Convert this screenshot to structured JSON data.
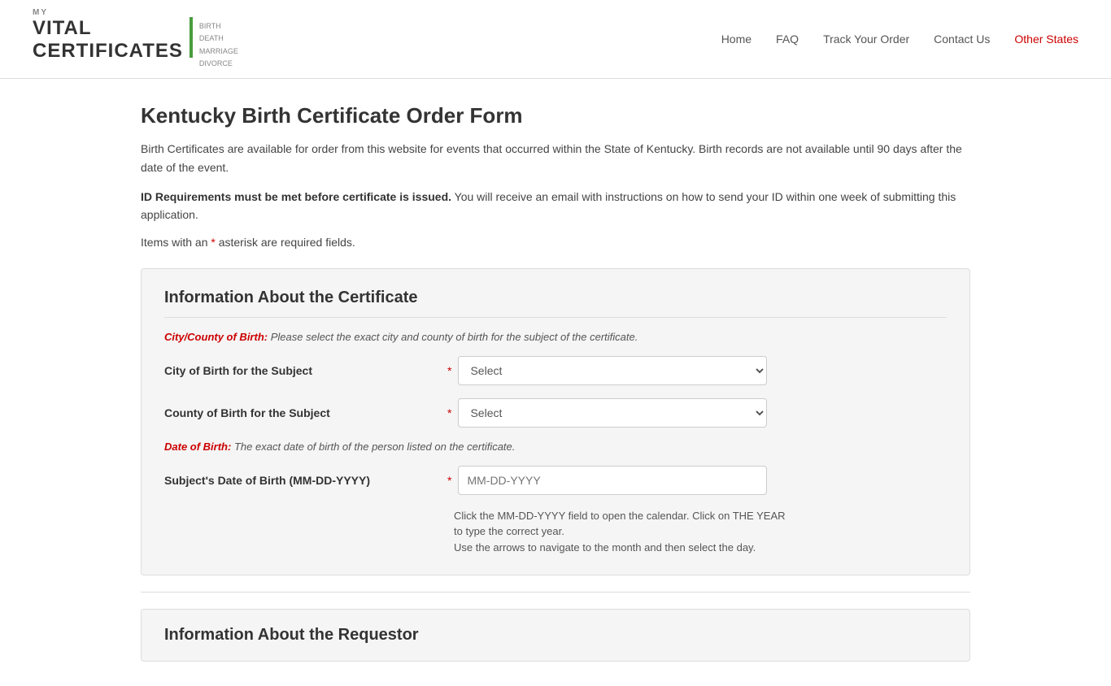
{
  "site": {
    "logo": {
      "my": "MY",
      "vital": "VITAL",
      "certificates": "CERTIFICATES",
      "subtitle_lines": [
        "BIRTH",
        "DEATH",
        "MARRIAGE",
        "DIVORCE"
      ]
    }
  },
  "nav": {
    "items": [
      {
        "label": "Home",
        "href": "#",
        "active": false
      },
      {
        "label": "FAQ",
        "href": "#",
        "active": false
      },
      {
        "label": "Track Your Order",
        "href": "#",
        "active": false
      },
      {
        "label": "Contact Us",
        "href": "#",
        "active": false
      },
      {
        "label": "Other States",
        "href": "#",
        "active": true
      }
    ]
  },
  "page": {
    "title": "Kentucky Birth Certificate Order Form",
    "description": "Birth Certificates are available for order from this website for events that occurred within the State of Kentucky. Birth records are not available until 90 days after the date of the event.",
    "id_req_bold": "ID Requirements must be met before certificate is issued.",
    "id_req_text": " You will receive an email with instructions on how to send your ID within one week of submitting this application.",
    "required_note_before": "Items with an ",
    "required_note_asterisk": "*",
    "required_note_after": " asterisk are required fields."
  },
  "form": {
    "section1_title": "Information About the Certificate",
    "city_county_label": "City/County of Birth:",
    "city_county_note": "  Please select the exact city and county of birth for the subject of the certificate.",
    "city_field_label": "City of Birth for the Subject",
    "city_select_default": "Select",
    "county_field_label": "County of Birth for the Subject",
    "county_select_default": "Select",
    "dob_label": "Date of Birth:",
    "dob_note": "  The exact date of birth of the person listed on the certificate.",
    "dob_field_label": "Subject's Date of Birth (MM-DD-YYYY)",
    "dob_placeholder": "MM-DD-YYYY",
    "dob_helper1": "Click the MM-DD-YYYY field to open the calendar. Click on THE YEAR to type the correct year.",
    "dob_helper2": "Use the arrows to navigate to the month and then select the day.",
    "section2_title": "Information About the Requestor"
  }
}
